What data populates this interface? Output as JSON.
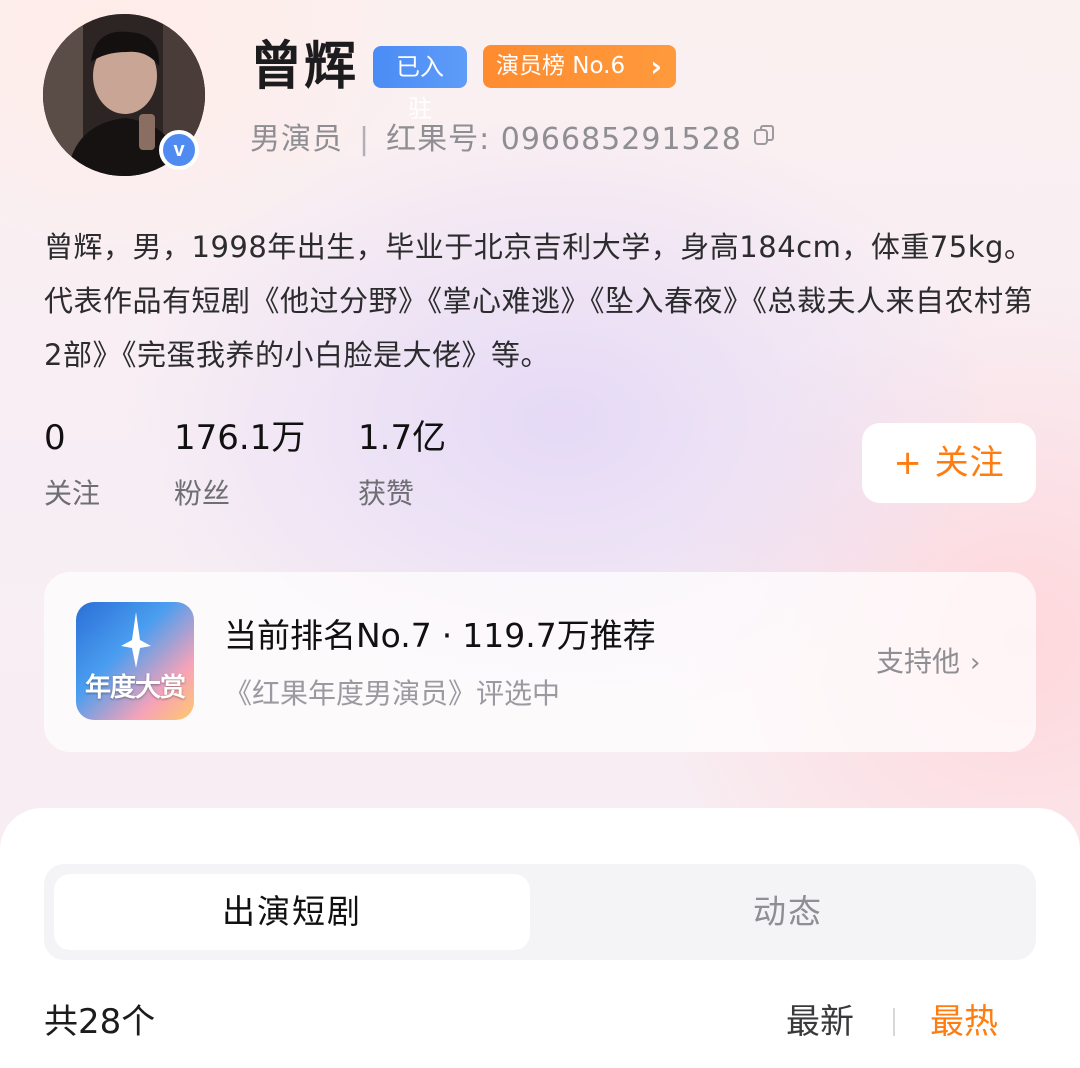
{
  "profile": {
    "name": "曾辉",
    "joined_badge": "已入驻",
    "rank_badge": "演员榜 No.6",
    "role": "男演员",
    "separator": "|",
    "id_label": "红果号: 096685291528",
    "verified_mark": "v",
    "bio": "曾辉，男，1998年出生，毕业于北京吉利大学，身高184cm，体重75kg。代表作品有短剧《他过分野》《掌心难逃》《坠入春夜》《总裁夫人来自农村第2部》《完蛋我养的小白脸是大佬》等。"
  },
  "stats": [
    {
      "value": "0",
      "label": "关注"
    },
    {
      "value": "176.1万",
      "label": "粉丝"
    },
    {
      "value": "1.7亿",
      "label": "获赞"
    }
  ],
  "follow_button": "+ 关注",
  "award": {
    "icon_text": "年度大赏",
    "title_rank": "当前排名No.7",
    "title_dot": "·",
    "title_votes": "119.7万推荐",
    "subtitle": "《红果年度男演员》评选中",
    "support_label": "支持他",
    "support_chevron": "›"
  },
  "tabs": [
    {
      "label": "出演短剧",
      "active": true
    },
    {
      "label": "动态",
      "active": false
    }
  ],
  "list": {
    "count": "共28个",
    "sort_latest": "最新",
    "sort_hot": "最热"
  },
  "colors": {
    "accent_orange": "#ff7d10",
    "badge_blue": "#4a8cf6",
    "verified_blue": "#4f8bf0"
  },
  "icons": {
    "verified": "verified-check-icon",
    "copy": "copy-icon",
    "chevron": "chevron-right-icon",
    "award": "award-star-icon"
  }
}
